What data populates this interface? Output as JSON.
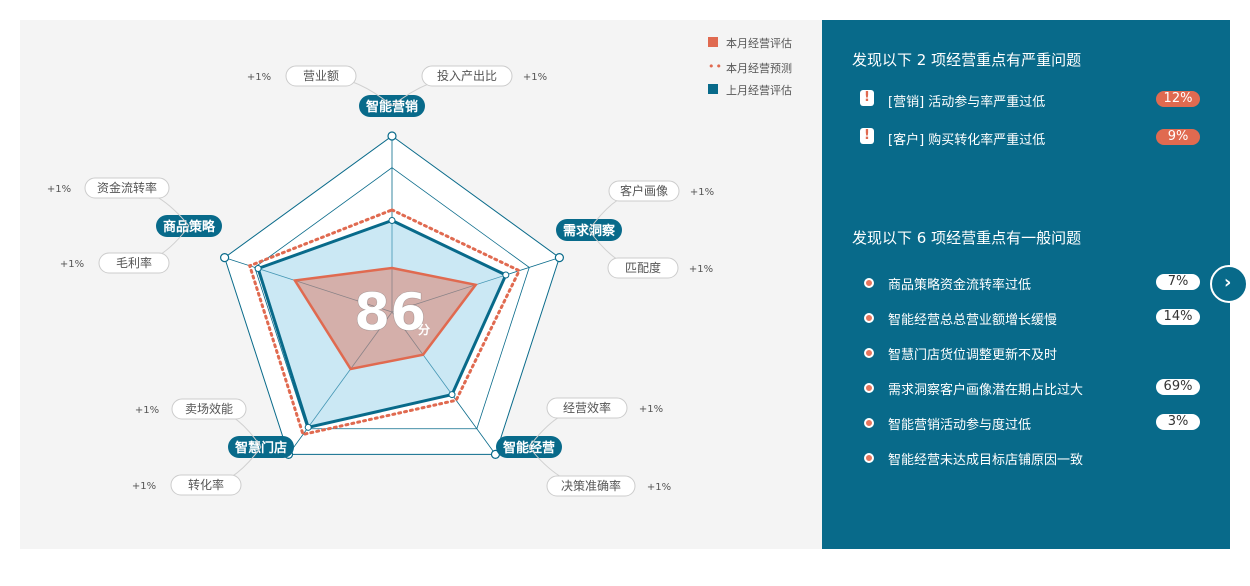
{
  "chart_data": {
    "type": "radar",
    "axes": [
      {
        "name": "智能营销",
        "current": 0.25,
        "forecast": 0.58,
        "last": 0.52
      },
      {
        "name": "需求洞察",
        "current": 0.5,
        "forecast": 0.76,
        "last": 0.68
      },
      {
        "name": "智能经营",
        "current": 0.3,
        "forecast": 0.62,
        "last": 0.58
      },
      {
        "name": "智慧门店",
        "current": 0.4,
        "forecast": 0.86,
        "last": 0.81
      },
      {
        "name": "商品策略",
        "current": 0.58,
        "forecast": 0.85,
        "last": 0.8
      }
    ],
    "legend": [
      "本月经营评估",
      "本月经营预测",
      "上月经营评估"
    ],
    "score": "86",
    "score_unit": "分",
    "sub_items": [
      {
        "label": "营业额",
        "delta": "+1%"
      },
      {
        "label": "投入产出比",
        "delta": "+1%"
      },
      {
        "label": "客户画像",
        "delta": "+1%"
      },
      {
        "label": "匹配度",
        "delta": "+1%"
      },
      {
        "label": "经营效率",
        "delta": "+1%"
      },
      {
        "label": "决策准确率",
        "delta": "+1%"
      },
      {
        "label": "卖场效能",
        "delta": "+1%"
      },
      {
        "label": "转化率",
        "delta": "+1%"
      },
      {
        "label": "资金流转率",
        "delta": "+1%"
      },
      {
        "label": "毛利率",
        "delta": "+1%"
      }
    ],
    "colors": {
      "current": "#e06a50",
      "forecast": "#e06a50",
      "last": "#086a8a"
    }
  },
  "right_panel": {
    "severe_title": "发现以下 2 项经营重点有严重问题",
    "severe_items": [
      {
        "text": "[营销] 活动参与率严重过低",
        "badge": "12%"
      },
      {
        "text": "[客户] 购买转化率严重过低",
        "badge": "9%"
      }
    ],
    "general_title": "发现以下 6 项经营重点有一般问题",
    "general_items": [
      {
        "text": "商品策略资金流转率过低",
        "badge": "7%"
      },
      {
        "text": "智能经营总总营业额增长缓慢",
        "badge": "14%"
      },
      {
        "text": "智慧门店货位调整更新不及时",
        "badge": ""
      },
      {
        "text": "需求洞察客户画像潜在期占比过大",
        "badge": "69%"
      },
      {
        "text": "智能营销活动参与度过低",
        "badge": "3%"
      },
      {
        "text": "智能经营未达成目标店铺原因一致",
        "badge": ""
      }
    ]
  },
  "icons": {
    "severe": "exclamation-icon",
    "general": "dot-icon",
    "next": "chevron-right-icon"
  }
}
